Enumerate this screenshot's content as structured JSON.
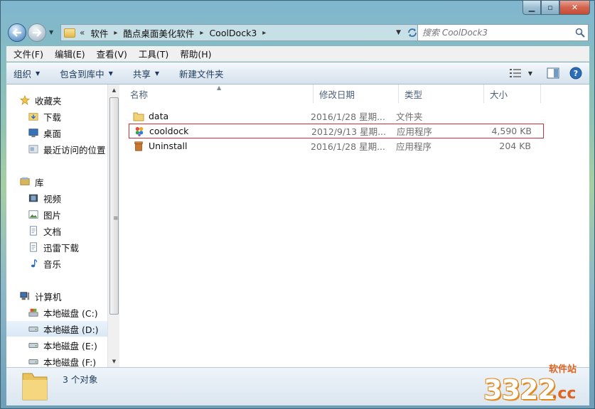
{
  "window": {
    "caption": {
      "minimize": "▁",
      "maximize": "▫",
      "close": "✕"
    }
  },
  "address": {
    "overflow": "«",
    "crumbs": [
      "软件",
      "酷点桌面美化软件",
      "CoolDock3"
    ],
    "separator": "▸"
  },
  "search": {
    "placeholder": "搜索 CoolDock3"
  },
  "menu": {
    "items": [
      "文件(F)",
      "编辑(E)",
      "查看(V)",
      "工具(T)",
      "帮助(H)"
    ]
  },
  "toolbar": {
    "organize": "组织",
    "include_library": "包含到库中",
    "share": "共享",
    "new_folder": "新建文件夹"
  },
  "nav": {
    "favorites": {
      "label": "收藏夹",
      "items": [
        "下载",
        "桌面",
        "最近访问的位置"
      ]
    },
    "libraries": {
      "label": "库",
      "items": [
        "视频",
        "图片",
        "文档",
        "迅雷下载",
        "音乐"
      ]
    },
    "computer": {
      "label": "计算机",
      "items": [
        "本地磁盘 (C:)",
        "本地磁盘 (D:)",
        "本地磁盘 (E:)",
        "本地磁盘 (F:)"
      ]
    }
  },
  "columns": {
    "name": "名称",
    "date": "修改日期",
    "type": "类型",
    "size": "大小"
  },
  "files": [
    {
      "name": "data",
      "date": "2016/1/28 星期...",
      "type": "文件夹",
      "size": "",
      "icon": "folder-icon"
    },
    {
      "name": "cooldock",
      "date": "2012/9/13 星期...",
      "type": "应用程序",
      "size": "4,590 KB",
      "icon": "cooldock-app-icon",
      "highlighted": true
    },
    {
      "name": "Uninstall",
      "date": "2016/1/28 星期...",
      "type": "应用程序",
      "size": "204 KB",
      "icon": "uninstall-icon"
    }
  ],
  "status": {
    "text": "3 个对象"
  },
  "watermark": {
    "number": "3322",
    "suffix": ".cc",
    "label": "软件站"
  },
  "colors": {
    "highlight_border": "#c8303a",
    "accent": "#1e395b",
    "watermark": "#e0631f"
  }
}
